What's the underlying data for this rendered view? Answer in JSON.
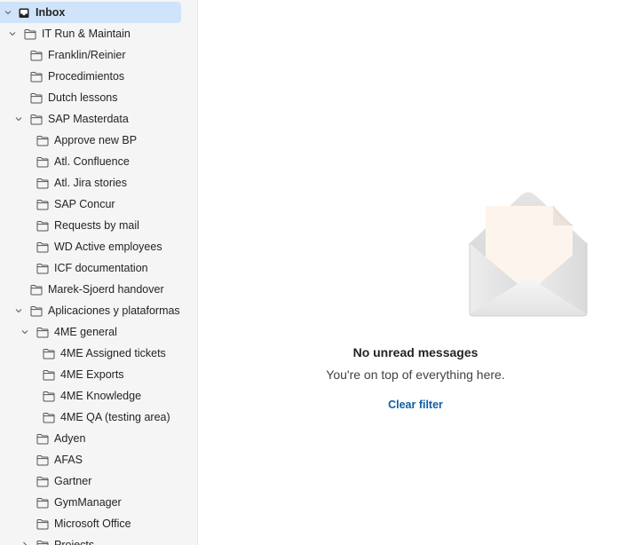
{
  "sidebar": {
    "folders": [
      {
        "label": "Inbox",
        "icon": "inbox-icon",
        "chevron": "down",
        "level": 0,
        "selected": true
      },
      {
        "label": "IT Run & Maintain",
        "icon": "folder-icon",
        "chevron": "down",
        "level": 1
      },
      {
        "label": "Franklin/Reinier",
        "icon": "folder-icon",
        "chevron": "",
        "level": 2
      },
      {
        "label": "Procedimientos",
        "icon": "folder-icon",
        "chevron": "",
        "level": 2
      },
      {
        "label": "Dutch lessons",
        "icon": "folder-icon",
        "chevron": "",
        "level": 2
      },
      {
        "label": "SAP Masterdata",
        "icon": "folder-icon",
        "chevron": "down",
        "level": 2
      },
      {
        "label": "Approve new BP",
        "icon": "folder-icon",
        "chevron": "",
        "level": 3
      },
      {
        "label": "Atl. Confluence",
        "icon": "folder-icon",
        "chevron": "",
        "level": 3
      },
      {
        "label": "Atl. Jira stories",
        "icon": "folder-icon",
        "chevron": "",
        "level": 3
      },
      {
        "label": "SAP Concur",
        "icon": "folder-icon",
        "chevron": "",
        "level": 3
      },
      {
        "label": "Requests by mail",
        "icon": "folder-icon",
        "chevron": "",
        "level": 3
      },
      {
        "label": "WD Active employees",
        "icon": "folder-icon",
        "chevron": "",
        "level": 3
      },
      {
        "label": "ICF documentation",
        "icon": "folder-icon",
        "chevron": "",
        "level": 3
      },
      {
        "label": "Marek-Sjoerd handover",
        "icon": "folder-icon",
        "chevron": "",
        "level": 2
      },
      {
        "label": "Aplicaciones y plataformas",
        "icon": "folder-icon",
        "chevron": "down",
        "level": 2
      },
      {
        "label": "4ME general",
        "icon": "folder-icon",
        "chevron": "down",
        "level": 3
      },
      {
        "label": "4ME Assigned tickets",
        "icon": "folder-icon",
        "chevron": "",
        "level": 4
      },
      {
        "label": "4ME Exports",
        "icon": "folder-icon",
        "chevron": "",
        "level": 4
      },
      {
        "label": "4ME Knowledge",
        "icon": "folder-icon",
        "chevron": "",
        "level": 4
      },
      {
        "label": "4ME QA (testing area)",
        "icon": "folder-icon",
        "chevron": "",
        "level": 4
      },
      {
        "label": "Adyen",
        "icon": "folder-icon",
        "chevron": "",
        "level": 3
      },
      {
        "label": "AFAS",
        "icon": "folder-icon",
        "chevron": "",
        "level": 3
      },
      {
        "label": "Gartner",
        "icon": "folder-icon",
        "chevron": "",
        "level": 3
      },
      {
        "label": "GymManager",
        "icon": "folder-icon",
        "chevron": "",
        "level": 3
      },
      {
        "label": "Microsoft Office",
        "icon": "folder-icon",
        "chevron": "",
        "level": 3
      },
      {
        "label": "Projects",
        "icon": "folder-icon",
        "chevron": "right",
        "level": 3
      }
    ]
  },
  "main": {
    "empty_state": {
      "illustration": "open-envelope-illustration",
      "title": "No unread messages",
      "subtitle": "You're on top of everything here.",
      "action_label": "Clear filter"
    }
  },
  "colors": {
    "sidebar_bg": "#f5f5f5",
    "selected_bg": "#cfe4fa",
    "link": "#115ea3",
    "text": "#242424"
  }
}
